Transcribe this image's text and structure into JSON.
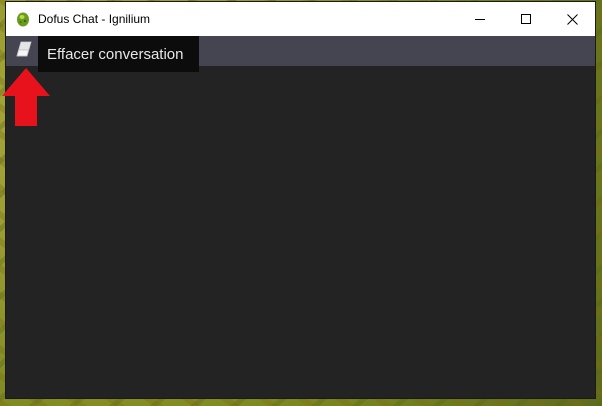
{
  "window": {
    "title": "Dofus Chat - Ignilium",
    "app_icon": "dofus-egg-icon",
    "controls": [
      "minimize-icon",
      "maximize-icon",
      "close-icon"
    ]
  },
  "toolbar": {
    "clear_button_icon": "eraser-icon",
    "clear_tooltip": "Effacer conversation"
  },
  "annotation": {
    "arrow_icon": "red-up-arrow-icon",
    "arrow_color": "#e8121c"
  },
  "colors": {
    "toolbar_bg": "#454552",
    "chat_bg": "#232323",
    "tooltip_bg": "#0c0c0c"
  }
}
